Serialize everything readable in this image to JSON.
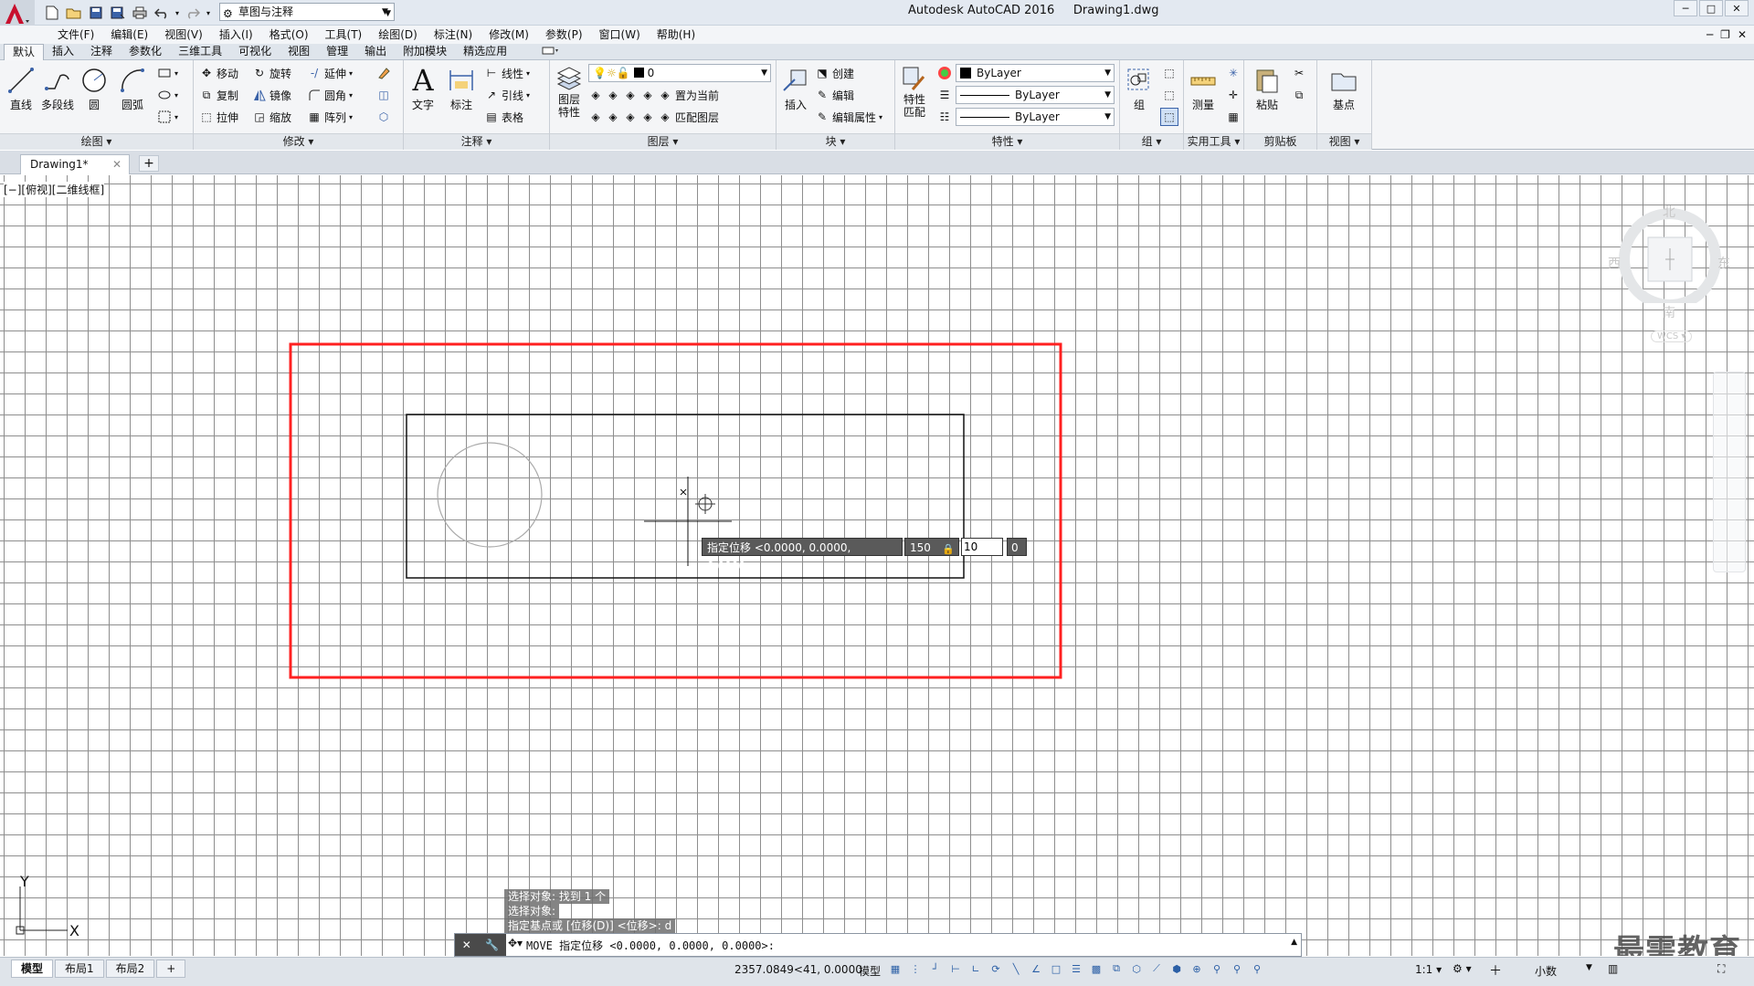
{
  "app": {
    "title": "Autodesk AutoCAD 2016     Drawing1.dwg",
    "workspace": "草图与注释",
    "window_min": "─",
    "window_max": "□",
    "window_close": "✕",
    "doc_min": "─",
    "doc_restore": "❐",
    "doc_close": "✕"
  },
  "menu": [
    "文件(F)",
    "编辑(E)",
    "视图(V)",
    "插入(I)",
    "格式(O)",
    "工具(T)",
    "绘图(D)",
    "标注(N)",
    "修改(M)",
    "参数(P)",
    "窗口(W)",
    "帮助(H)"
  ],
  "ribbon_tabs": [
    "默认",
    "插入",
    "注释",
    "参数化",
    "三维工具",
    "可视化",
    "视图",
    "管理",
    "输出",
    "附加模块",
    "精选应用"
  ],
  "panels": {
    "draw": {
      "title": "绘图 ▾",
      "line": "直线",
      "polyline": "多段线",
      "circle": "圆",
      "arc": "圆弧"
    },
    "modify": {
      "title": "修改 ▾",
      "move": "移动",
      "rotate": "旋转",
      "extend": "延伸",
      "copy": "复制",
      "mirror": "镜像",
      "fillet": "圆角",
      "stretch": "拉伸",
      "scale": "缩放",
      "array": "阵列"
    },
    "annotation": {
      "title": "注释 ▾",
      "text": "文字",
      "dim": "标注",
      "linear": "线性",
      "leader": "引线",
      "table": "表格"
    },
    "layers": {
      "title": "图层 ▾",
      "props": "图层\n特性",
      "current_layer": "0",
      "make_current": "置为当前",
      "match": "匹配图层"
    },
    "block": {
      "title": "块 ▾",
      "insert": "插入",
      "create": "创建",
      "edit": "编辑",
      "edit_attr": "编辑属性"
    },
    "properties": {
      "title": "特性 ▾",
      "match": "特性\n匹配",
      "color": "ByLayer",
      "linetype": "ByLayer",
      "lineweight": "ByLayer"
    },
    "group": {
      "title": "组 ▾",
      "group": "组"
    },
    "utilities": {
      "title": "实用工具 ▾",
      "measure": "测量"
    },
    "clipboard": {
      "title": "剪贴板",
      "paste": "粘贴"
    },
    "view": {
      "title": "视图 ▾",
      "base": "基点"
    }
  },
  "file_tab": {
    "name": "Drawing1*",
    "close": "✕",
    "new": "+"
  },
  "viewport_label": "[−][俯视][二维线框]",
  "viewcube": {
    "north": "北",
    "south": "南",
    "east": "东",
    "west": "西",
    "wcs": "WCS"
  },
  "dynamic_input": {
    "prompt": "指定位移 <0.0000, 0.0000, 0.0000>:",
    "x": "150",
    "y": "10",
    "z": "0"
  },
  "ucs": {
    "x": "X",
    "y": "Y"
  },
  "command_history": [
    "选择对象: 找到 1 个",
    "选择对象:",
    "指定基点或 [位移(D)] <位移>: d"
  ],
  "command_line": "MOVE 指定位移 <0.0000, 0.0000, 0.0000>:",
  "layout_tabs": [
    "模型",
    "布局1",
    "布局2"
  ],
  "layout_add": "+",
  "status": {
    "coords": "2357.0849<41, 0.0000",
    "model": "模型",
    "scale": "1:1 ▾",
    "units": "小数"
  },
  "watermark": "最需教育",
  "colors": {
    "highlight": "#ff2020",
    "cmd_bg": "#4a4a4a",
    "grid": "#8e8e8e"
  }
}
